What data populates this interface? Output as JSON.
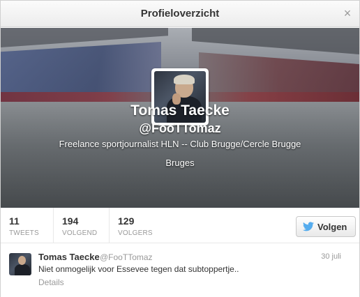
{
  "dialog": {
    "title": "Profieloverzicht",
    "close_glyph": "×",
    "close_icon": "close-icon"
  },
  "profile": {
    "name": "Tomas Taecke",
    "handle": "@FooTTomaz",
    "bio": "Freelance sportjournalist HLN -- Club Brugge/Cercle Brugge",
    "location": "Bruges",
    "header_image": "stadium-header-image",
    "avatar": "profile-avatar-image"
  },
  "stats": [
    {
      "value": "11",
      "label": "TWEETS"
    },
    {
      "value": "194",
      "label": "VOLGEND"
    },
    {
      "value": "129",
      "label": "VOLGERS"
    }
  ],
  "follow_button": {
    "label": "Volgen",
    "icon": "twitter-bird-icon",
    "icon_color": "#55acee"
  },
  "tweet": {
    "name": "Tomas Taecke",
    "handle": "@FooTTomaz",
    "date": "30 juli",
    "text": "Niet onmogelijk voor Essevee tegen dat subtoppertje..",
    "details_label": "Details"
  }
}
